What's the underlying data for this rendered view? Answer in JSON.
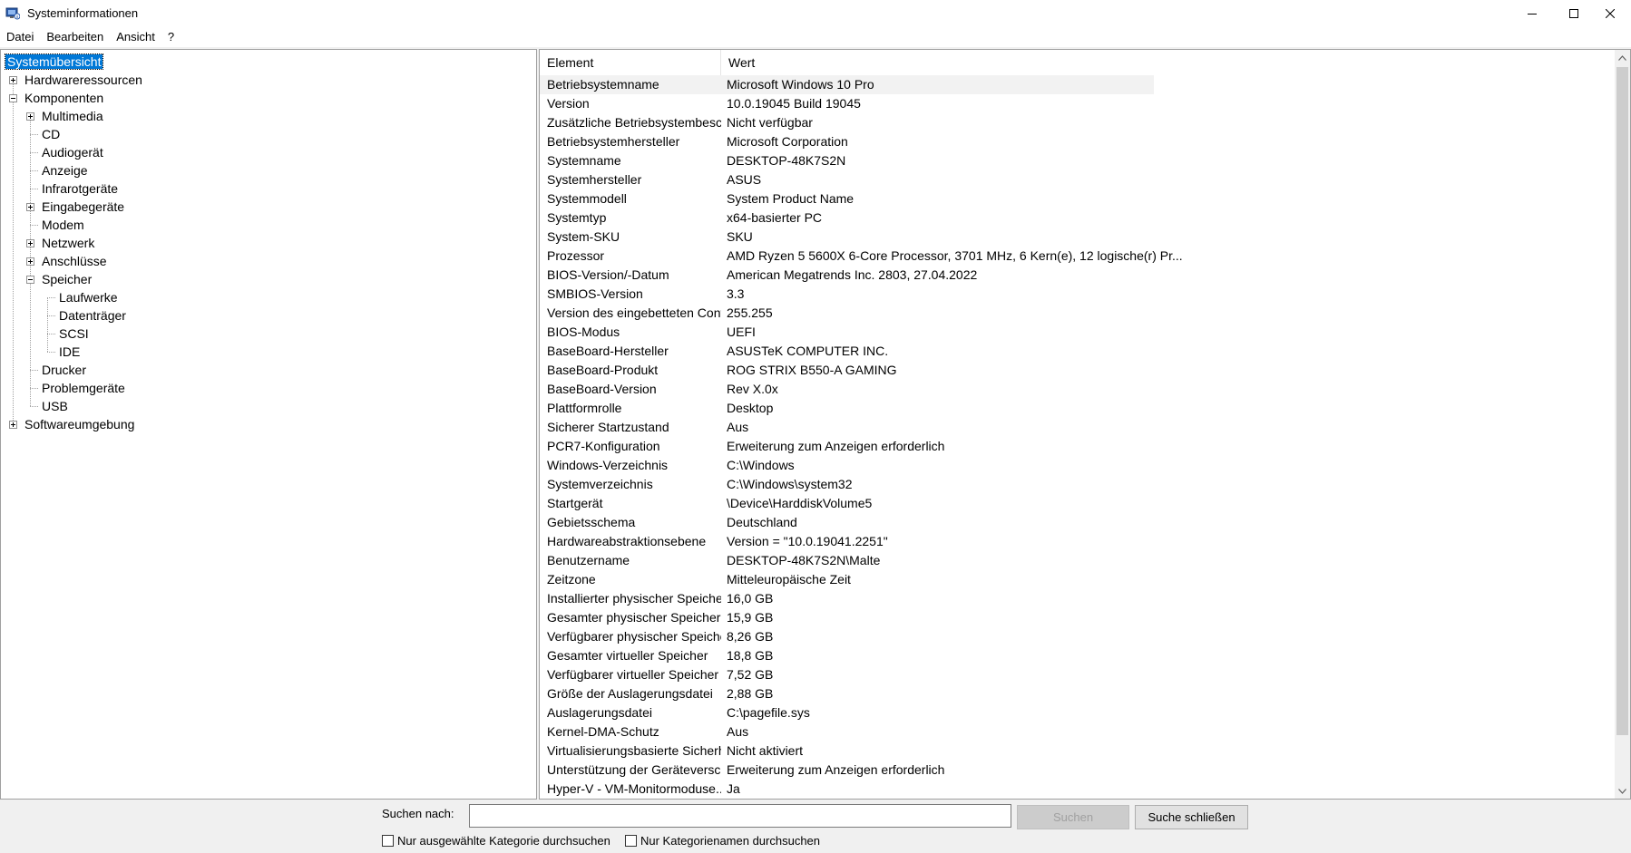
{
  "window": {
    "title": "Systeminformationen",
    "controls": [
      "minimize",
      "maximize",
      "close"
    ]
  },
  "menu": [
    "Datei",
    "Bearbeiten",
    "Ansicht",
    "?"
  ],
  "tree": [
    {
      "label": "Systemübersicht",
      "level": 0,
      "expander": "none",
      "selected": true
    },
    {
      "label": "Hardwareressourcen",
      "level": 0,
      "expander": "plus"
    },
    {
      "label": "Komponenten",
      "level": 0,
      "expander": "minus"
    },
    {
      "label": "Multimedia",
      "level": 1,
      "expander": "plus"
    },
    {
      "label": "CD",
      "level": 1,
      "expander": "none"
    },
    {
      "label": "Audiogerät",
      "level": 1,
      "expander": "none"
    },
    {
      "label": "Anzeige",
      "level": 1,
      "expander": "none"
    },
    {
      "label": "Infrarotgeräte",
      "level": 1,
      "expander": "none"
    },
    {
      "label": "Eingabegeräte",
      "level": 1,
      "expander": "plus"
    },
    {
      "label": "Modem",
      "level": 1,
      "expander": "none"
    },
    {
      "label": "Netzwerk",
      "level": 1,
      "expander": "plus"
    },
    {
      "label": "Anschlüsse",
      "level": 1,
      "expander": "plus"
    },
    {
      "label": "Speicher",
      "level": 1,
      "expander": "minus"
    },
    {
      "label": "Laufwerke",
      "level": 2,
      "expander": "none"
    },
    {
      "label": "Datenträger",
      "level": 2,
      "expander": "none"
    },
    {
      "label": "SCSI",
      "level": 2,
      "expander": "none"
    },
    {
      "label": "IDE",
      "level": 2,
      "expander": "none"
    },
    {
      "label": "Drucker",
      "level": 1,
      "expander": "none"
    },
    {
      "label": "Problemgeräte",
      "level": 1,
      "expander": "none"
    },
    {
      "label": "USB",
      "level": 1,
      "expander": "none"
    },
    {
      "label": "Softwareumgebung",
      "level": 0,
      "expander": "plus"
    }
  ],
  "list": {
    "headers": [
      "Element",
      "Wert"
    ],
    "rows": [
      [
        "Betriebsystemname",
        "Microsoft Windows 10 Pro"
      ],
      [
        "Version",
        "10.0.19045 Build 19045"
      ],
      [
        "Zusätzliche Betriebsystembesch...",
        "Nicht verfügbar"
      ],
      [
        "Betriebsystemhersteller",
        "Microsoft Corporation"
      ],
      [
        "Systemname",
        "DESKTOP-48K7S2N"
      ],
      [
        "Systemhersteller",
        "ASUS"
      ],
      [
        "Systemmodell",
        "System Product Name"
      ],
      [
        "Systemtyp",
        "x64-basierter PC"
      ],
      [
        "System-SKU",
        "SKU"
      ],
      [
        "Prozessor",
        "AMD Ryzen 5 5600X 6-Core Processor, 3701 MHz, 6 Kern(e), 12 logische(r) Pr..."
      ],
      [
        "BIOS-Version/-Datum",
        "American Megatrends Inc. 2803, 27.04.2022"
      ],
      [
        "SMBIOS-Version",
        "3.3"
      ],
      [
        "Version des eingebetteten Cont...",
        "255.255"
      ],
      [
        "BIOS-Modus",
        "UEFI"
      ],
      [
        "BaseBoard-Hersteller",
        "ASUSTeK COMPUTER INC."
      ],
      [
        "BaseBoard-Produkt",
        "ROG STRIX B550-A GAMING"
      ],
      [
        "BaseBoard-Version",
        "Rev X.0x"
      ],
      [
        "Plattformrolle",
        "Desktop"
      ],
      [
        "Sicherer Startzustand",
        "Aus"
      ],
      [
        "PCR7-Konfiguration",
        "Erweiterung zum Anzeigen erforderlich"
      ],
      [
        "Windows-Verzeichnis",
        "C:\\Windows"
      ],
      [
        "Systemverzeichnis",
        "C:\\Windows\\system32"
      ],
      [
        "Startgerät",
        "\\Device\\HarddiskVolume5"
      ],
      [
        "Gebietsschema",
        "Deutschland"
      ],
      [
        "Hardwareabstraktionsebene",
        "Version = \"10.0.19041.2251\""
      ],
      [
        "Benutzername",
        "DESKTOP-48K7S2N\\Malte"
      ],
      [
        "Zeitzone",
        "Mitteleuropäische Zeit"
      ],
      [
        "Installierter physischer Speicher...",
        "16,0 GB"
      ],
      [
        "Gesamter physischer Speicher",
        "15,9 GB"
      ],
      [
        "Verfügbarer physischer Speicher",
        "8,26 GB"
      ],
      [
        "Gesamter virtueller Speicher",
        "18,8 GB"
      ],
      [
        "Verfügbarer virtueller Speicher",
        "7,52 GB"
      ],
      [
        "Größe der Auslagerungsdatei",
        "2,88 GB"
      ],
      [
        "Auslagerungsdatei",
        "C:\\pagefile.sys"
      ],
      [
        "Kernel-DMA-Schutz",
        "Aus"
      ],
      [
        "Virtualisierungsbasierte Sicherh...",
        "Nicht aktiviert"
      ],
      [
        "Unterstützung der Geräteversc...",
        "Erweiterung zum Anzeigen erforderlich"
      ],
      [
        "Hyper-V - VM-Monitormoduse...",
        "Ja"
      ]
    ]
  },
  "search": {
    "label": "Suchen nach:",
    "value": "",
    "search_button": "Suchen",
    "close_button": "Suche schließen",
    "checkbox_selected_category": "Nur ausgewählte Kategorie durchsuchen",
    "checkbox_category_names": "Nur Kategorienamen durchsuchen"
  },
  "colors": {
    "selection": "#0078d7",
    "window_bg": "#f0f0f0",
    "pane_bg": "#ffffff"
  }
}
